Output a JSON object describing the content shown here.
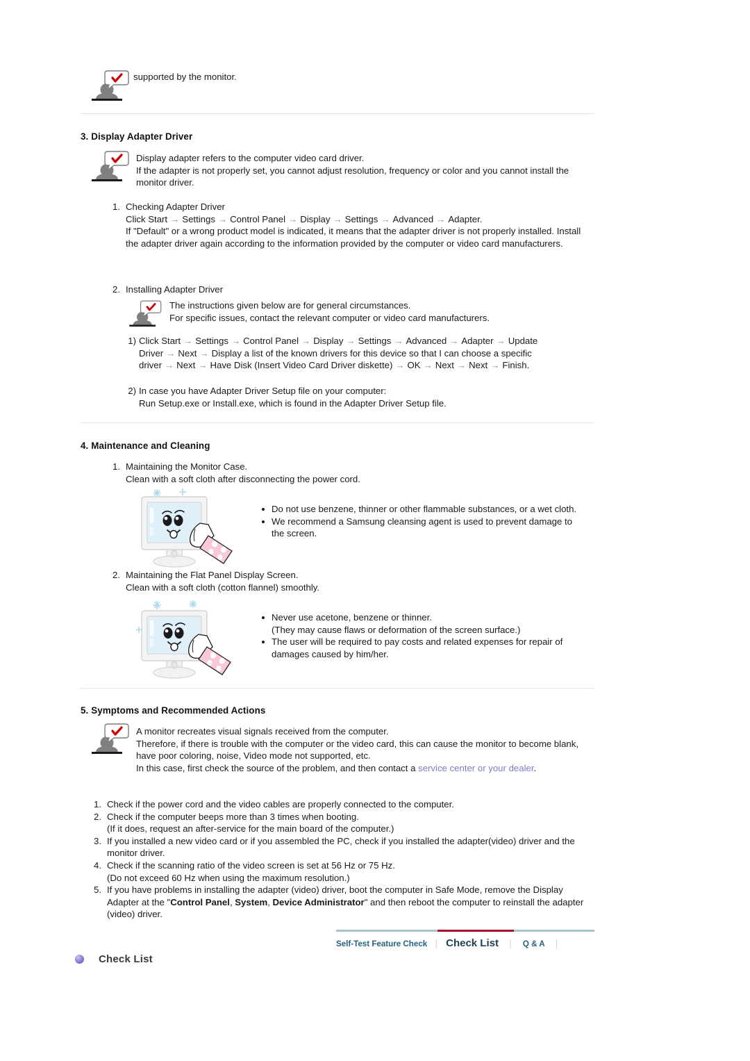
{
  "top_note": {
    "icon": "person-note-icon",
    "text": "supported by the monitor."
  },
  "section3": {
    "heading": "3. Display Adapter Driver",
    "note": {
      "icon": "person-note-icon",
      "lines": [
        "Display adapter refers to the computer video card driver.",
        "If the adapter is not properly set, you cannot adjust resolution, frequency or color and you cannot install the monitor driver."
      ]
    },
    "items": [
      {
        "marker": "1.",
        "title": "Checking Adapter Driver",
        "path_prefix": "Click Start",
        "path_steps": [
          "Settings",
          "Control Panel",
          "Display",
          "Settings",
          "Advanced",
          "Adapter."
        ],
        "body": "If \"Default\" or a wrong product model is indicated, it means that the adapter driver is not properly installed. Install the adapter driver again according to the information provided by the computer or video card manufacturers."
      },
      {
        "marker": "2.",
        "title": "Installing Adapter Driver",
        "note": {
          "icon": "person-note-icon",
          "lines": [
            "The instructions given below are for general circumstances.",
            "For specific issues, contact the relevant computer or video card manufacturers."
          ]
        },
        "subitems": [
          {
            "marker": "1)",
            "path_prefix": "Click Start",
            "path_steps": [
              "Settings",
              "Control Panel",
              "Display",
              "Settings",
              "Advanced",
              "Adapter",
              "Update Driver",
              "Next",
              "Display a list of the known drivers for this device so that I can choose a specific driver",
              "Next",
              "Have Disk (Insert Video Card Driver diskette)",
              "OK",
              "Next",
              "Next",
              "Finish."
            ]
          },
          {
            "marker": "2)",
            "lines": [
              "In case you have Adapter Driver Setup file on your computer:",
              "Run Setup.exe or Install.exe, which is found in the Adapter Driver Setup file."
            ]
          }
        ]
      }
    ]
  },
  "section4": {
    "heading": "4. Maintenance and Cleaning",
    "items": [
      {
        "marker": "1.",
        "lines": [
          "Maintaining the Monitor Case.",
          "Clean with a soft cloth after disconnecting the power cord."
        ],
        "illustration": "monitor-cleaning-illustration",
        "bullets": [
          "Do not use benzene, thinner or other flammable substances, or a wet cloth.",
          "We recommend a Samsung cleansing agent is used to prevent damage to the screen."
        ]
      },
      {
        "marker": "2.",
        "lines": [
          "Maintaining the Flat Panel Display Screen.",
          "Clean with a soft cloth (cotton flannel) smoothly."
        ],
        "illustration": "monitor-cleaning-illustration",
        "bullets": [
          "Never use acetone, benzene or thinner.\n(They may cause flaws or deformation of the screen surface.)",
          "The user will be required to pay costs and related expenses for repair of damages caused by him/her."
        ]
      }
    ]
  },
  "section5": {
    "heading": "5. Symptoms and Recommended Actions",
    "note": {
      "icon": "person-note-icon",
      "line1": "A monitor recreates visual signals received from the computer.",
      "line2": "Therefore, if there is trouble with the computer or the video card, this can cause the monitor to become blank, have poor coloring, noise, Video mode not supported, etc.",
      "line3_before": "In this case, first check the source of the problem, and then contact a ",
      "line3_link": "service center or your dealer",
      "line3_after": "."
    },
    "checks": [
      {
        "marker": "1.",
        "text": "Check if the power cord and the video cables are properly connected to the computer."
      },
      {
        "marker": "2.",
        "text": "Check if the computer beeps more than 3 times when booting.\n(If it does, request an after-service for the main board of the computer.)"
      },
      {
        "marker": "3.",
        "text": "If you installed a new video card or if you assembled the PC, check if you installed the adapter(video) driver and the monitor driver."
      },
      {
        "marker": "4.",
        "text": "Check if the scanning ratio of the video screen is set at 56 Hz or 75 Hz.\n(Do not exceed 60 Hz when using the maximum resolution.)"
      },
      {
        "marker": "5.",
        "prefix": "If you have problems in installing the adapter (video) driver, boot the computer in Safe Mode, remove the Display Adapter at the \"",
        "bold1": "Control Panel",
        "mid1": ", ",
        "bold2": "System",
        "mid2": ", ",
        "bold3": "Device Administrator",
        "suffix": "\" and then reboot the computer to reinstall the adapter (video) driver."
      }
    ]
  },
  "footer_nav": {
    "items": [
      {
        "label": "Self-Test Feature Check",
        "current": false
      },
      {
        "label": "Check List",
        "current": true
      },
      {
        "label": "Q & A",
        "current": false
      }
    ],
    "separator": "│",
    "bar_color": "#a9c3c9",
    "active_color": "#a4132c"
  },
  "bottom_title": {
    "bullet": "purple-sphere-bullet",
    "label": "Check List"
  },
  "colors": {
    "link": "#7b7fc4",
    "arrow": "#8d8d8d",
    "rule": "#e2e2e2",
    "nav_text": "#24627f",
    "nav_current": "#1e3f53"
  }
}
